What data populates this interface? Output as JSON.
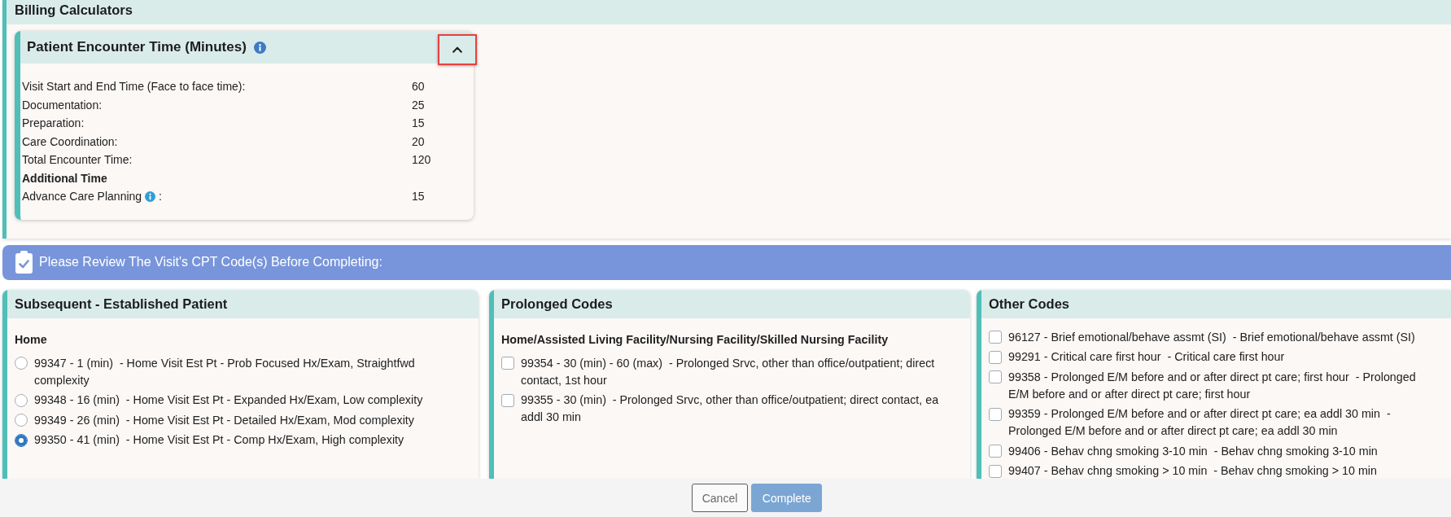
{
  "billing_calculators": {
    "title": "Billing Calculators",
    "encounter_panel": {
      "title": "Patient Encounter Time (Minutes)",
      "expanded": true,
      "highlighted": true,
      "rows": [
        {
          "kind": "time",
          "label": "Visit Start and End Time (Face to face time):",
          "value": "60"
        },
        {
          "kind": "time",
          "label": "Documentation:",
          "value": "25"
        },
        {
          "kind": "time",
          "label": "Preparation:",
          "value": "15"
        },
        {
          "kind": "time",
          "label": "Care Coordination:",
          "value": "20"
        },
        {
          "kind": "time",
          "label": "Total Encounter Time:",
          "value": "120"
        },
        {
          "kind": "heading",
          "label": "Additional Time"
        },
        {
          "kind": "time_info",
          "label": "Advance Care Planning",
          "suffix": ":",
          "value": "15"
        }
      ]
    }
  },
  "cpt_banner": {
    "text": "Please Review The Visit's CPT Code(s) Before Completing:"
  },
  "code_panels": [
    {
      "title": "Subsequent - Established Patient",
      "subtitle": "Home",
      "kind": "radio",
      "codes": [
        {
          "text": "99347 - 1 (min)  - Home Visit Est Pt - Prob Focused Hx/Exam, Straightfwd complexity",
          "selected": false
        },
        {
          "text": "99348 - 16 (min)  - Home Visit Est Pt - Expanded Hx/Exam, Low complexity",
          "selected": false
        },
        {
          "text": "99349 - 26 (min)  - Home Visit Est Pt - Detailed Hx/Exam, Mod complexity",
          "selected": false
        },
        {
          "text": "99350 - 41 (min)  - Home Visit Est Pt - Comp Hx/Exam, High complexity",
          "selected": true
        }
      ]
    },
    {
      "title": "Prolonged Codes",
      "subtitle": "Home/Assisted Living Facility/Nursing Facility/Skilled Nursing Facility",
      "kind": "checkbox",
      "codes": [
        {
          "text": "99354 - 30 (min) - 60 (max)  - Prolonged Srvc, other than office/outpatient; direct contact, 1st hour",
          "checked": false
        },
        {
          "text": "99355 - 30 (min)  - Prolonged Srvc, other than office/outpatient; direct contact, ea addl 30 min",
          "checked": false
        }
      ]
    },
    {
      "title": "Other Codes",
      "kind": "checkbox",
      "codes": [
        {
          "text": "96127 - Brief emotional/behave assmt (SI)  - Brief emotional/behave assmt (SI)",
          "checked": false
        },
        {
          "text": "99291 - Critical care first hour  - Critical care first hour",
          "checked": false
        },
        {
          "text": "99358 - Prolonged E/M before and or after direct pt care; first hour  - Prolonged E/M before and or after direct pt care; first hour",
          "checked": false
        },
        {
          "text": "99359 - Prolonged E/M before and or after direct pt care; ea addl 30 min  - Prolonged E/M before and or after direct pt care; ea addl 30 min",
          "checked": false
        },
        {
          "text": "99406 - Behav chng smoking 3-10 min  - Behav chng smoking 3-10 min",
          "checked": false
        },
        {
          "text": "99407 - Behav chng smoking > 10 min  - Behav chng smoking > 10 min",
          "checked": false
        }
      ]
    }
  ],
  "footer": {
    "buttons": [
      {
        "label": "Cancel",
        "kind": "secondary"
      },
      {
        "label": "Complete",
        "kind": "primary"
      }
    ]
  }
}
